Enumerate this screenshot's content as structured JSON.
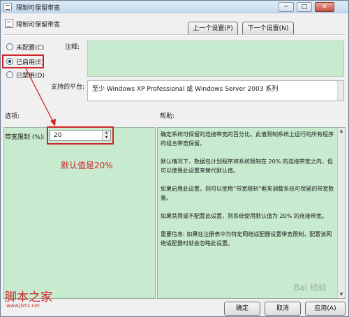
{
  "window": {
    "title": "限制可保留带宽",
    "min": "─",
    "max": "□",
    "close": "✕"
  },
  "header": {
    "title": "限制可保留带宽",
    "prev_button": "上一个设置(P)",
    "next_button": "下一个设置(N)"
  },
  "state": {
    "options": [
      {
        "label": "未配置(C)",
        "checked": false
      },
      {
        "label": "已启用(E)",
        "checked": true
      },
      {
        "label": "已禁用(D)",
        "checked": false
      }
    ]
  },
  "comment_label": "注释:",
  "platform_label": "支持的平台:",
  "platform_value": "至少 Windows XP Professional 或 Windows Server 2003 系列",
  "options_label": "选项:",
  "help_label": "帮助:",
  "bandwidth": {
    "label": "带宽限制 (%):",
    "value": "20"
  },
  "annotation_text": "默认值是20%",
  "help_paragraphs": [
    "确定系统可保留的连接带宽的百分比。此值限制系统上运行的所有程序的组合带宽保留。",
    "默认情况下，数据包计划程序将系统限制在 20% 的连接带宽之内，但可以使用此设置来替代默认值。",
    "如果启用此设置，则可以使用“带宽限制”框来调整系统可保留的带宽数量。",
    "如果禁用或不配置此设置，则系统使用默认值为 20% 的连接带宽。",
    "重要信息: 如果在注册表中为特定网络适配器设置带宽限制，配置该网络适配器时就会忽略此设置。"
  ],
  "buttons": {
    "ok": "确定",
    "cancel": "取消",
    "apply": "应用(A)"
  },
  "footer": {
    "logo": "脚本之家",
    "url": "www.jb51.net",
    "watermark": "Bai 经验"
  },
  "colors": {
    "panel_green": "#c8ebcf",
    "annotation_red": "#d0262b"
  }
}
